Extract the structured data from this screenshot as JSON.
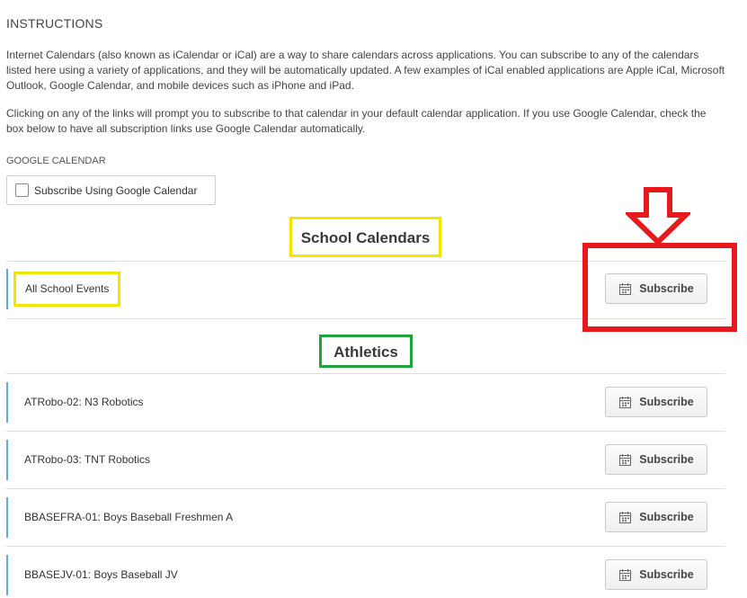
{
  "instructions": {
    "heading": "INSTRUCTIONS",
    "paragraph1": "Internet Calendars (also known as iCalendar or iCal) are a way to share calendars across applications. You can subscribe to any of the calendars listed here using a variety of applications, and they will be automatically updated. A few examples of iCal enabled applications are Apple iCal, Microsoft Outlook, Google Calendar, and mobile devices such as iPhone and iPad.",
    "paragraph2": "Clicking on any of the links will prompt you to subscribe to that calendar in your default calendar application. If you use Google Calendar, check the box below to have all subscription links use Google Calendar automatically."
  },
  "google_calendar": {
    "label": "GOOGLE CALENDAR",
    "checkbox_label": "Subscribe Using Google Calendar",
    "checked": false
  },
  "sections": [
    {
      "title": "School Calendars",
      "highlight_color": "#f2e600",
      "items": [
        {
          "name": "All School Events",
          "button_label": "Subscribe"
        }
      ]
    },
    {
      "title": "Athletics",
      "highlight_color": "#1fa33a",
      "items": [
        {
          "name": "ATRobo-02: N3 Robotics",
          "button_label": "Subscribe"
        },
        {
          "name": "ATRobo-03: TNT Robotics",
          "button_label": "Subscribe"
        },
        {
          "name": "BBASEFRA-01: Boys Baseball Freshmen A",
          "button_label": "Subscribe"
        },
        {
          "name": "BBASEJV-01: Boys Baseball JV",
          "button_label": "Subscribe"
        }
      ]
    }
  ],
  "annotations": {
    "arrow_color": "#e8191d",
    "box_color": "#e8191d"
  },
  "colors": {
    "row_accent": "#5aaedc",
    "divider": "#dddddd"
  }
}
